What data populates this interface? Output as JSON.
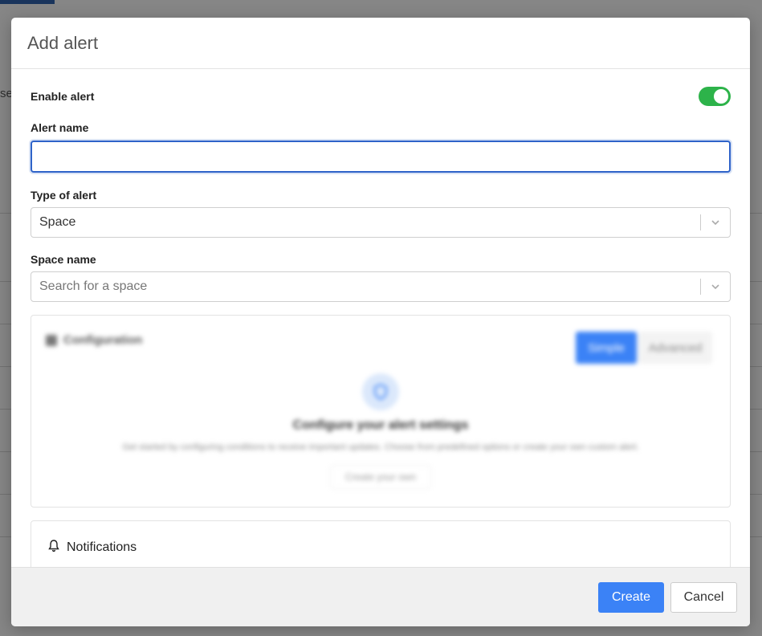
{
  "background": {
    "partial_text": "se"
  },
  "modal": {
    "title": "Add alert",
    "enable": {
      "label": "Enable alert",
      "on": true,
      "color": "#2db34a"
    },
    "alert_name": {
      "label": "Alert name",
      "value": "",
      "placeholder": ""
    },
    "alert_type": {
      "label": "Type of alert",
      "value": "Space"
    },
    "space_name": {
      "label": "Space name",
      "placeholder": "Search for a space"
    },
    "configuration": {
      "title": "Configuration",
      "mode_simple": "Simple",
      "mode_advanced": "Advanced",
      "heading": "Configure your alert settings",
      "description": "Get started by configuring conditions to receive important updates. Choose from predefined options or create your own custom alert.",
      "create_label": "Create your own"
    },
    "notifications": {
      "title": "Notifications"
    },
    "footer": {
      "create": "Create",
      "cancel": "Cancel"
    },
    "accent_color": "#3b82f6"
  }
}
